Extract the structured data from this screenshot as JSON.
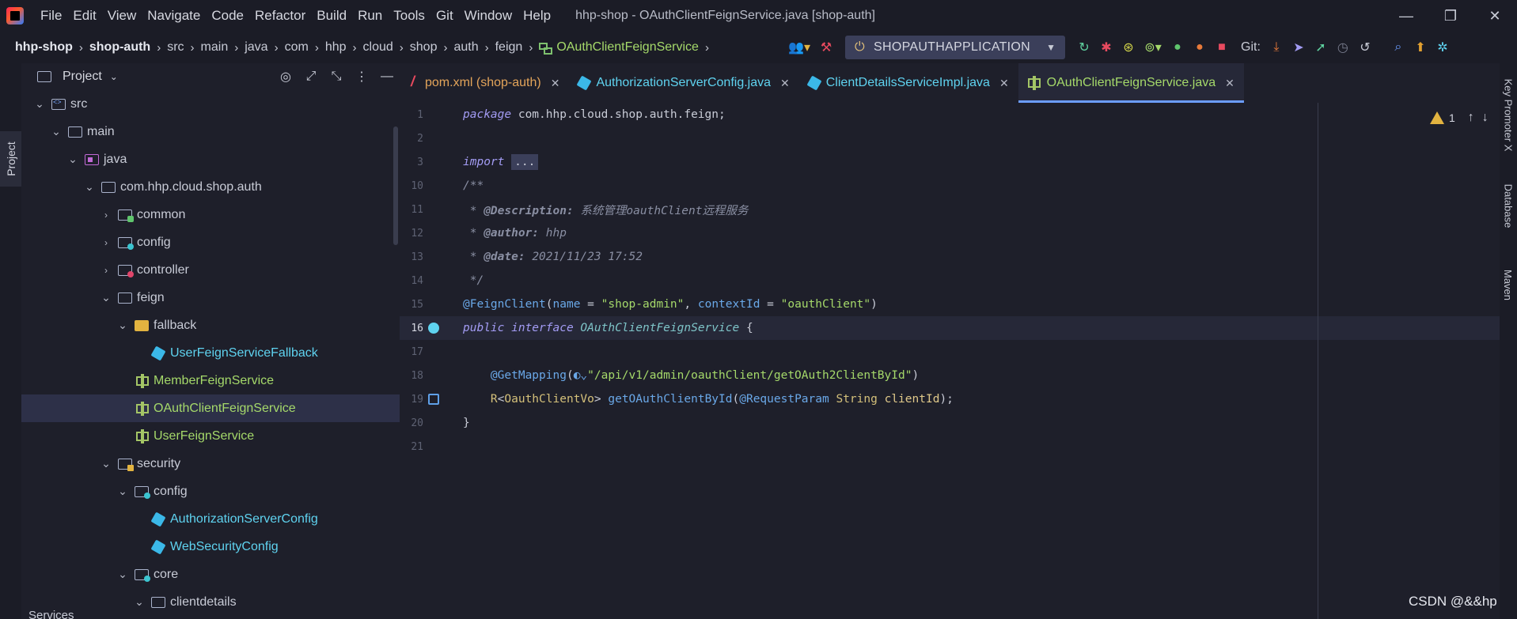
{
  "menubar": {
    "items": [
      "File",
      "Edit",
      "View",
      "Navigate",
      "Code",
      "Refactor",
      "Build",
      "Run",
      "Tools",
      "Git",
      "Window",
      "Help"
    ],
    "window_title": "hhp-shop - OAuthClientFeignService.java [shop-auth]",
    "controls": [
      "—",
      "❐",
      "✕"
    ]
  },
  "breadcrumbs": [
    "hhp-shop",
    "shop-auth",
    "src",
    "main",
    "java",
    "com",
    "hhp",
    "cloud",
    "shop",
    "auth",
    "feign",
    "OAuthClientFeignService"
  ],
  "toolbar": {
    "run_config": "SHOPAUTHAPPLICATION",
    "git_label": "Git:"
  },
  "left_strip": {
    "project_tab": "Project"
  },
  "project_panel": {
    "title": "Project",
    "tree": [
      {
        "label": "src",
        "depth": 2,
        "expanded": true,
        "icon": "folder-src-icon",
        "kind": "pkg"
      },
      {
        "label": "main",
        "depth": 3,
        "expanded": true,
        "icon": "folder-icon",
        "kind": "pkg"
      },
      {
        "label": "java",
        "depth": 4,
        "expanded": true,
        "icon": "folder-java-icon",
        "kind": "pkg"
      },
      {
        "label": "com.hhp.cloud.shop.auth",
        "depth": 5,
        "expanded": true,
        "icon": "package-icon",
        "kind": "pkg"
      },
      {
        "label": "common",
        "depth": 6,
        "expanded": false,
        "icon": "folder-green-icon",
        "kind": "pkg"
      },
      {
        "label": "config",
        "depth": 6,
        "expanded": false,
        "icon": "folder-cyan-icon",
        "kind": "pkg"
      },
      {
        "label": "controller",
        "depth": 6,
        "expanded": false,
        "icon": "folder-red-icon",
        "kind": "pkg"
      },
      {
        "label": "feign",
        "depth": 6,
        "expanded": true,
        "icon": "package-icon",
        "kind": "pkg"
      },
      {
        "label": "fallback",
        "depth": 7,
        "expanded": true,
        "icon": "folder-yellow-icon",
        "kind": "pkg"
      },
      {
        "label": "UserFeignServiceFallback",
        "depth": 8,
        "icon": "class-icon",
        "kind": "class"
      },
      {
        "label": "MemberFeignService",
        "depth": 7,
        "icon": "interface-icon",
        "kind": "iface"
      },
      {
        "label": "OAuthClientFeignService",
        "depth": 7,
        "icon": "interface-icon",
        "kind": "iface",
        "selected": true
      },
      {
        "label": "UserFeignService",
        "depth": 7,
        "icon": "interface-icon",
        "kind": "iface"
      },
      {
        "label": "security",
        "depth": 6,
        "expanded": true,
        "icon": "folder-lock-icon",
        "kind": "pkg"
      },
      {
        "label": "config",
        "depth": 7,
        "expanded": true,
        "icon": "folder-cyan-icon",
        "kind": "pkg"
      },
      {
        "label": "AuthorizationServerConfig",
        "depth": 8,
        "icon": "class-icon",
        "kind": "class"
      },
      {
        "label": "WebSecurityConfig",
        "depth": 8,
        "icon": "class-icon",
        "kind": "class"
      },
      {
        "label": "core",
        "depth": 7,
        "expanded": true,
        "icon": "folder-cyan-icon",
        "kind": "pkg"
      },
      {
        "label": "clientdetails",
        "depth": 8,
        "expanded": true,
        "icon": "package-icon",
        "kind": "pkg"
      }
    ]
  },
  "tabs": [
    {
      "label": "pom.xml (shop-auth)",
      "kind": "xml",
      "active": false
    },
    {
      "label": "AuthorizationServerConfig.java",
      "kind": "java",
      "active": false
    },
    {
      "label": "ClientDetailsServiceImpl.java",
      "kind": "java",
      "active": false
    },
    {
      "label": "OAuthClientFeignService.java",
      "kind": "iface",
      "active": true
    }
  ],
  "editor": {
    "warning_count": "1",
    "lines": [
      {
        "n": "1",
        "parts": [
          [
            "c-kw",
            "package"
          ],
          [
            "c-plain",
            " com.hhp.cloud.shop.auth.feign;"
          ]
        ]
      },
      {
        "n": "2",
        "parts": []
      },
      {
        "n": "3",
        "parts": [
          [
            "c-kw",
            "import"
          ],
          [
            "c-plain",
            " "
          ],
          [
            "c-fold",
            "..."
          ]
        ]
      },
      {
        "n": "10",
        "parts": [
          [
            "c-doc",
            "/**"
          ]
        ]
      },
      {
        "n": "11",
        "parts": [
          [
            "c-doc",
            " * "
          ],
          [
            "c-doctag",
            "@Description:"
          ],
          [
            "c-doc",
            " 系统管理oauthClient远程服务"
          ]
        ]
      },
      {
        "n": "12",
        "parts": [
          [
            "c-doc",
            " * "
          ],
          [
            "c-doctag",
            "@author:"
          ],
          [
            "c-doc",
            " hhp"
          ]
        ]
      },
      {
        "n": "13",
        "parts": [
          [
            "c-doc",
            " * "
          ],
          [
            "c-doctag",
            "@date:"
          ],
          [
            "c-doc",
            " 2021/11/23 17:52"
          ]
        ]
      },
      {
        "n": "14",
        "parts": [
          [
            "c-doc",
            " */"
          ]
        ]
      },
      {
        "n": "15",
        "parts": [
          [
            "c-ann",
            "@FeignClient"
          ],
          [
            "c-plain",
            "("
          ],
          [
            "c-ann",
            "name"
          ],
          [
            "c-plain",
            " = "
          ],
          [
            "c-str",
            "\"shop-admin\""
          ],
          [
            "c-plain",
            ", "
          ],
          [
            "c-ann",
            "contextId"
          ],
          [
            "c-plain",
            " = "
          ],
          [
            "c-str",
            "\"oauthClient\""
          ],
          [
            "c-plain",
            ")"
          ]
        ]
      },
      {
        "n": "16",
        "current": true,
        "gutter": "impl",
        "parts": [
          [
            "c-kw",
            "public interface"
          ],
          [
            "c-plain",
            " "
          ],
          [
            "c-iface",
            "OAuthClientFeignService"
          ],
          [
            "c-plain",
            " {"
          ]
        ]
      },
      {
        "n": "17",
        "parts": []
      },
      {
        "n": "18",
        "parts": [
          [
            "c-plain",
            "    "
          ],
          [
            "c-ann",
            "@GetMapping"
          ],
          [
            "c-plain",
            "("
          ],
          [
            "c-ann",
            "◐⌄"
          ],
          [
            "c-str",
            "\"/api/v1/admin/oauthClient/getOAuth2ClientById\""
          ],
          [
            "c-plain",
            ")"
          ]
        ]
      },
      {
        "n": "19",
        "gutter": "mapping",
        "parts": [
          [
            "c-plain",
            "    "
          ],
          [
            "c-type",
            "R"
          ],
          [
            "c-plain",
            "<"
          ],
          [
            "c-type",
            "OauthClientVo"
          ],
          [
            "c-plain",
            "> "
          ],
          [
            "c-ann",
            "getOAuthClientById"
          ],
          [
            "c-plain",
            "("
          ],
          [
            "c-ann",
            "@RequestParam"
          ],
          [
            "c-plain",
            " "
          ],
          [
            "c-type",
            "String"
          ],
          [
            "c-plain",
            " "
          ],
          [
            "c-param",
            "clientId"
          ],
          [
            "c-plain",
            ");"
          ]
        ]
      },
      {
        "n": "20",
        "parts": [
          [
            "c-brace",
            "}"
          ]
        ]
      },
      {
        "n": "21",
        "parts": []
      }
    ]
  },
  "right_strip": [
    "Key Promoter X",
    "Database",
    "Maven"
  ],
  "bottom": {
    "services_label": "Services",
    "watermark": "CSDN @&&hp"
  },
  "colors": {
    "accent": "#6b9cff",
    "bg": "#1e1f2a",
    "panel": "#1b1c26"
  }
}
